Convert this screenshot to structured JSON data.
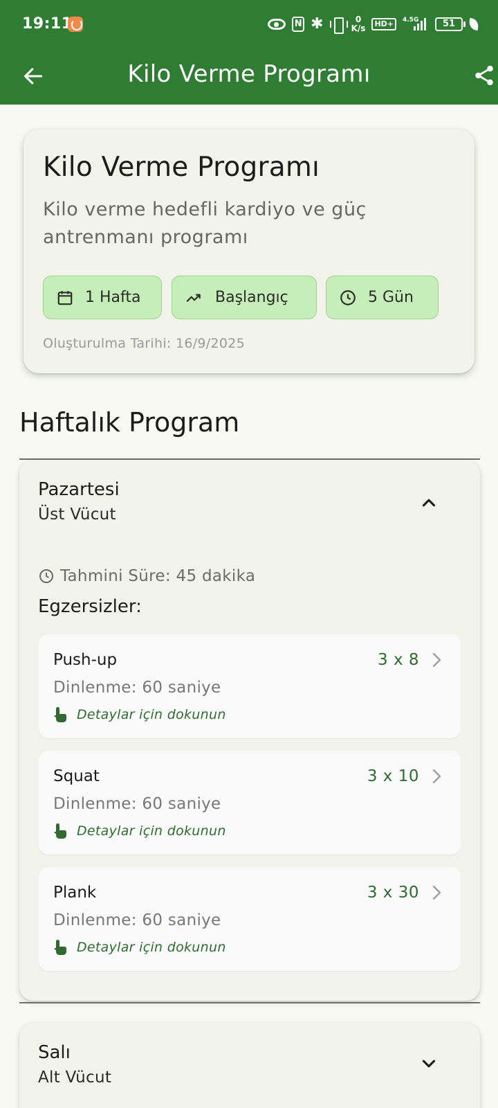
{
  "status_bar": {
    "time": "19:11",
    "network_speed_value": "0",
    "network_speed_unit": "K/s",
    "hd_label": "HD+",
    "network_type": "4.5G",
    "battery": "51",
    "accent_color": "#2e7d32"
  },
  "app_bar": {
    "title": "Kilo Verme Programı",
    "back_icon": "arrow-back-icon",
    "share_icon": "share-icon"
  },
  "program": {
    "title": "Kilo Verme Programı",
    "description": "Kilo verme hedefli kardiyo ve güç antrenmanı programı",
    "chips": {
      "duration": "1 Hafta",
      "level": "Başlangıç",
      "days": "5 Gün"
    },
    "created": "Oluşturulma Tarihi: 16/9/2025"
  },
  "section_heading": "Haftalık Program",
  "days": [
    {
      "name": "Pazartesi",
      "focus": "Üst Vücut",
      "expanded": true,
      "estimated_time": "Tahmini Süre: 45 dakika",
      "exercises_heading": "Egzersizler:",
      "exercises": [
        {
          "name": "Push-up",
          "sets": "3 x 8",
          "rest": "Dinlenme: 60 saniye",
          "hint": "Detaylar için dokunun"
        },
        {
          "name": "Squat",
          "sets": "3 x 10",
          "rest": "Dinlenme: 60 saniye",
          "hint": "Detaylar için dokunun"
        },
        {
          "name": "Plank",
          "sets": "3 x 30",
          "rest": "Dinlenme: 60 saniye",
          "hint": "Detaylar için dokunun"
        }
      ]
    },
    {
      "name": "Salı",
      "focus": "Alt Vücut",
      "expanded": false
    }
  ]
}
